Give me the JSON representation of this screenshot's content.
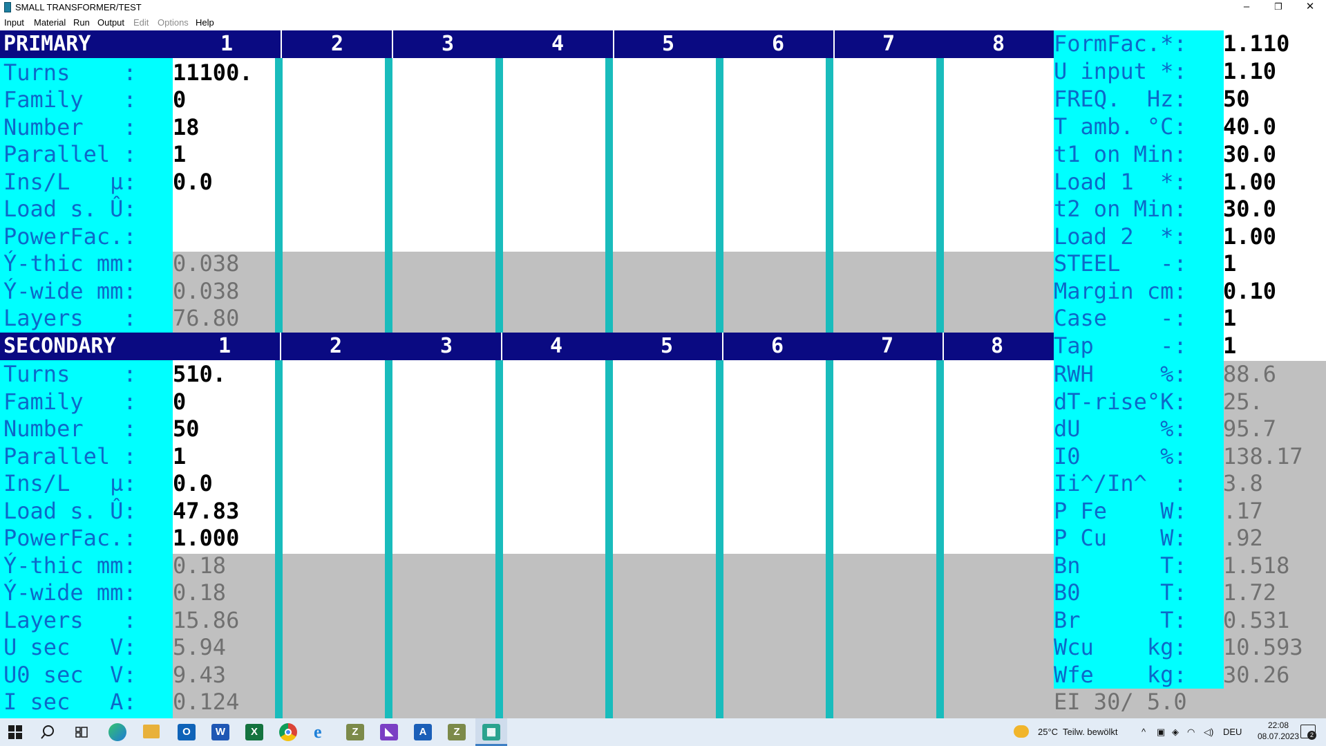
{
  "window": {
    "title": "SMALL TRANSFORMER/TEST",
    "minimize": "–",
    "maximize": "❐",
    "close": "✕"
  },
  "menu": {
    "input": "Input",
    "material": "Material",
    "run": "Run",
    "output": "Output",
    "edit": "Edit",
    "options": "Options",
    "help": "Help"
  },
  "primary": {
    "title": "PRIMARY",
    "columns": [
      "1",
      "2",
      "3",
      "4",
      "5",
      "6",
      "7",
      "8"
    ],
    "labels": [
      "Turns    :",
      "Family   :",
      "Number   :",
      "Parallel :",
      "Ins/L   µ:",
      "Load s. Û:",
      "PowerFac.:",
      "Ý-thic mm:",
      "Ý-wide mm:",
      "Layers   :"
    ],
    "values": [
      "11100.",
      "0",
      "18",
      "1",
      "0.0",
      "",
      "",
      "0.038",
      "0.038",
      "76.80"
    ]
  },
  "secondary": {
    "title": "SECONDARY",
    "columns": [
      "1",
      "2",
      "3",
      "4",
      "5",
      "6",
      "7",
      "8"
    ],
    "labels": [
      "Turns    :",
      "Family   :",
      "Number   :",
      "Parallel :",
      "Ins/L   µ:",
      "Load s. Û:",
      "PowerFac.:",
      "Ý-thic mm:",
      "Ý-wide mm:",
      "Layers   :",
      "U sec   V:",
      "U0 sec  V:",
      "I sec   A:"
    ],
    "values": [
      "510.",
      "0",
      "50",
      "1",
      "0.0",
      "47.83",
      "1.000",
      "0.18",
      "0.18",
      "15.86",
      "5.94",
      "9.43",
      "0.124"
    ]
  },
  "settings": {
    "labels": [
      "FormFac.*:",
      "U input *:",
      "FREQ.  Hz:",
      "T amb. °C:",
      "t1 on Min:",
      "Load 1  *:",
      "t2 on Min:",
      "Load 2  *:",
      "STEEL   -:",
      "Margin cm:",
      "Case    -:",
      "Tap     -:"
    ],
    "values": [
      "1.110",
      "1.10",
      "50",
      "40.0",
      "30.0",
      "1.00",
      "30.0",
      "1.00",
      "1",
      "0.10",
      "1",
      "1"
    ]
  },
  "results": {
    "labels": [
      "RWH     %:",
      "dT-rise°K:",
      "dU      %:",
      "I0      %:",
      "Ii^/In^  :",
      "P Fe    W:",
      "P Cu    W:",
      "Bn      T:",
      "B0      T:",
      "Br      T:",
      "Wcu    kg:",
      "Wfe    kg:"
    ],
    "values": [
      "88.6",
      "25.",
      "95.7",
      "138.17",
      "3.8",
      ".17",
      ".92",
      "1.518",
      "1.72",
      "0.531",
      "10.593",
      "30.26"
    ],
    "core": "EI 30/ 5.0"
  },
  "taskbar": {
    "weather": "25°C  Teilw. bewölkt",
    "lang": "DEU",
    "time": "22:08",
    "date": "08.07.2023",
    "notifications": "2",
    "app_letters": {
      "outlook": "O",
      "word": "W",
      "excel": "X",
      "zip1": "Z",
      "vs": "◣",
      "azure": "A",
      "zip2": "Z",
      "calc": "▦"
    }
  }
}
